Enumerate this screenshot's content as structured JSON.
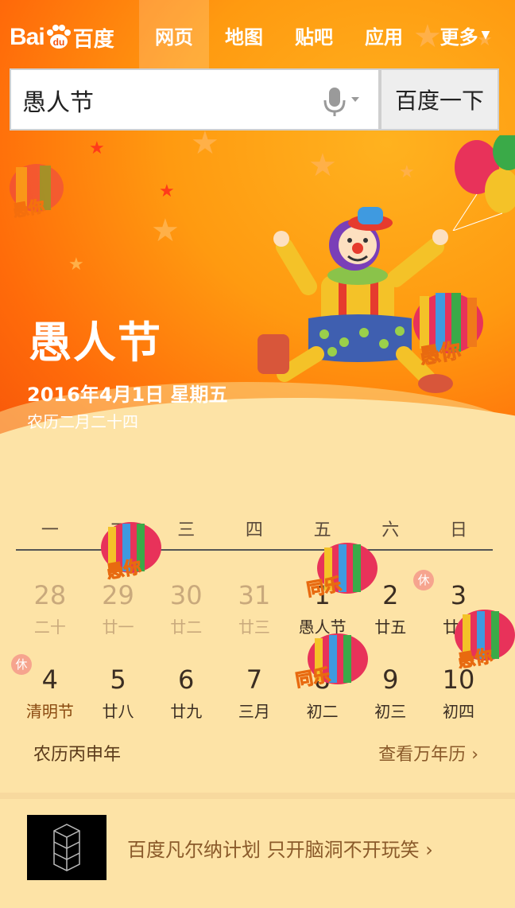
{
  "nav": {
    "logo_bai": "Bai",
    "logo_du": "du",
    "logo_cn": "百度",
    "tabs": [
      {
        "label": "网页",
        "active": true
      },
      {
        "label": "地图",
        "active": false
      },
      {
        "label": "贴吧",
        "active": false
      },
      {
        "label": "应用",
        "active": false
      },
      {
        "label": "更多",
        "active": false
      }
    ]
  },
  "search": {
    "query": "愚人节",
    "button": "百度一下"
  },
  "festival": {
    "title": "愚人节",
    "date": "2016年4月1日 星期五",
    "lunar": "农历二月二十四"
  },
  "calendar": {
    "weekdays": [
      "一",
      "二",
      "三",
      "四",
      "五",
      "六",
      "日"
    ],
    "rows": [
      [
        {
          "num": "28",
          "sub": "二十",
          "dim": true
        },
        {
          "num": "29",
          "sub": "廿一",
          "dim": true
        },
        {
          "num": "30",
          "sub": "廿二",
          "dim": true
        },
        {
          "num": "31",
          "sub": "廿三",
          "dim": true
        },
        {
          "num": "1",
          "sub": "愚人节",
          "dim": false
        },
        {
          "num": "2",
          "sub": "廿五",
          "dim": false
        },
        {
          "num": "3",
          "sub": "廿六",
          "dim": false,
          "rest": "休"
        }
      ],
      [
        {
          "num": "4",
          "sub": "清明节",
          "dim": false,
          "rest": "休",
          "holiday": true
        },
        {
          "num": "5",
          "sub": "廿八",
          "dim": false
        },
        {
          "num": "6",
          "sub": "廿九",
          "dim": false
        },
        {
          "num": "7",
          "sub": "三月",
          "dim": false
        },
        {
          "num": "8",
          "sub": "初二",
          "dim": false
        },
        {
          "num": "9",
          "sub": "初三",
          "dim": false
        },
        {
          "num": "10",
          "sub": "初四",
          "dim": false
        }
      ]
    ],
    "lunar_year": "农历丙申年",
    "view_almanac": "查看万年历"
  },
  "balloon_text": {
    "a": "愚你",
    "b": "同乐"
  },
  "promo": {
    "text": "百度凡尔纳计划 只开脑洞不开玩笑"
  },
  "colors": {
    "accent": "#ff6b0a",
    "sand": "#fde3a6"
  }
}
